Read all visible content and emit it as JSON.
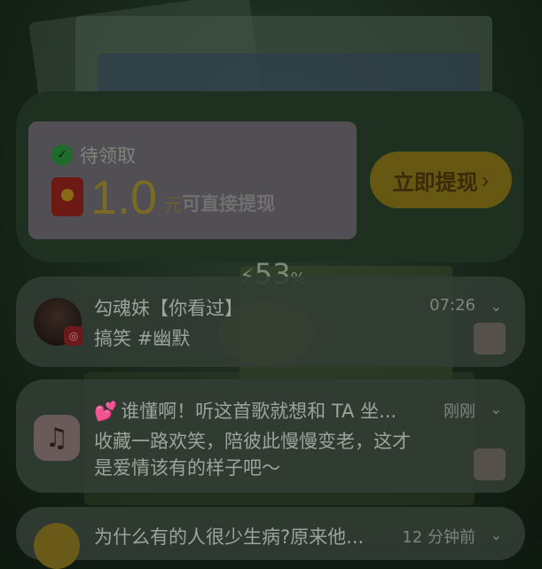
{
  "reward_card": {
    "pending_label": "待领取",
    "amount": "1.0",
    "unit": "元",
    "description": "可直接提现",
    "button_label": "立即提现",
    "button_chevron": "›"
  },
  "battery": {
    "bolt": "⚡",
    "level": "53",
    "percent_sign": "%"
  },
  "notifications": [
    {
      "title": "勾魂妹【你看过】",
      "body": "搞笑 #幽默",
      "time": "07:26",
      "expand_icon": "⌄",
      "avatar_badge": "◎"
    },
    {
      "title": "谁懂啊！听这首歌就想和 TA 坐...",
      "body_line1": "收藏一路欢笑，陪彼此慢慢变老，这才",
      "body_line2": "是爱情该有的样子吧～",
      "time": "刚刚",
      "expand_icon": "⌄",
      "app_icon": "♫",
      "heart": "💕"
    },
    {
      "title": "为什么有的人很少生病?原来他...",
      "time": "12 分钟前",
      "expand_icon": "⌄"
    }
  ],
  "colors": {
    "accent_gold": "#665812",
    "card_bg": "#1e301f",
    "notif_bg": "#323e34"
  }
}
